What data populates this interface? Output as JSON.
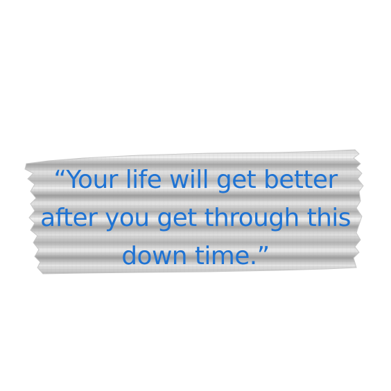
{
  "quote": {
    "line1": "“Your life will get better",
    "line2": "after you get through this",
    "line3": "down time.”"
  },
  "colors": {
    "text": "#1f73d3",
    "tape_light": "#e6e6e6",
    "tape_dark": "#9a9a9a",
    "background": "#ffffff"
  }
}
